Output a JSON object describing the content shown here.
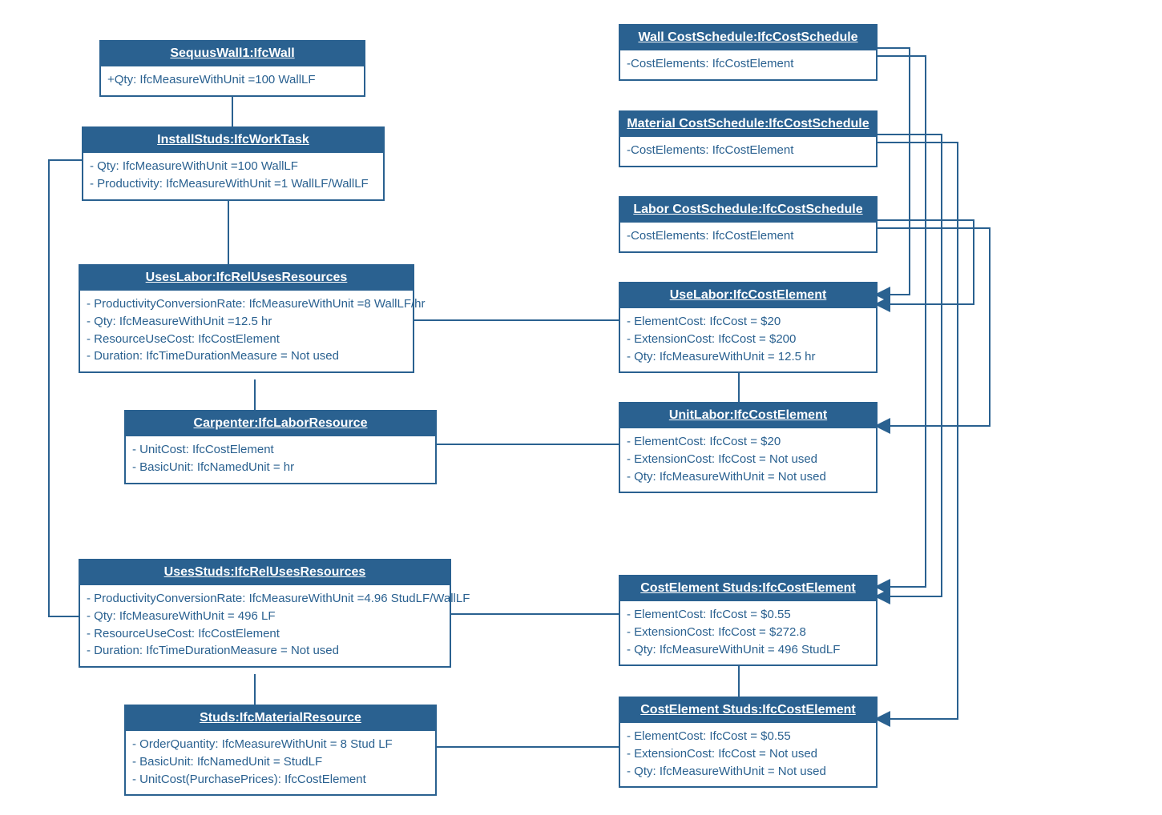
{
  "left": {
    "wall": {
      "title": "SequusWall1:IfcWall",
      "a1": "+Qty: IfcMeasureWithUnit =100 WallLF"
    },
    "install": {
      "title": "InstallStuds:IfcWorkTask",
      "a1": "- Qty: IfcMeasureWithUnit =100 WallLF",
      "a2": "- Productivity: IfcMeasureWithUnit =1 WallLF/WallLF"
    },
    "useslabor": {
      "title": "UsesLabor:IfcRelUsesResources",
      "a1": "- ProductivityConversionRate: IfcMeasureWithUnit =8 WallLF/hr",
      "a2": "- Qty: IfcMeasureWithUnit =12.5 hr",
      "a3": "- ResourceUseCost: IfcCostElement",
      "a4": "- Duration: IfcTimeDurationMeasure = Not used"
    },
    "carpenter": {
      "title": "Carpenter:IfcLaborResource",
      "a1": "- UnitCost: IfcCostElement",
      "a2": "- BasicUnit: IfcNamedUnit = hr"
    },
    "usesstuds": {
      "title": "UsesStuds:IfcRelUsesResources",
      "a1": "- ProductivityConversionRate: IfcMeasureWithUnit =4.96 StudLF/WallLF",
      "a2": "- Qty: IfcMeasureWithUnit = 496 LF",
      "a3": "- ResourceUseCost: IfcCostElement",
      "a4": "- Duration: IfcTimeDurationMeasure = Not used"
    },
    "studs": {
      "title": "Studs:IfcMaterialResource",
      "a1": "- OrderQuantity: IfcMeasureWithUnit = 8 Stud LF",
      "a2": "- BasicUnit: IfcNamedUnit = StudLF",
      "a3": "- UnitCost(PurchasePrices): IfcCostElement"
    }
  },
  "right": {
    "wallSched": {
      "title": "Wall CostSchedule:IfcCostSchedule",
      "a1": "-CostElements: IfcCostElement"
    },
    "matSched": {
      "title": "Material CostSchedule:IfcCostSchedule",
      "a1": "-CostElements: IfcCostElement"
    },
    "laborSched": {
      "title": "Labor CostSchedule:IfcCostSchedule",
      "a1": "-CostElements: IfcCostElement"
    },
    "useLaborCE": {
      "title": "UseLabor:IfcCostElement",
      "a1": "- ElementCost: IfcCost = $20",
      "a2": "- ExtensionCost: IfcCost = $200",
      "a3": "- Qty: IfcMeasureWithUnit = 12.5 hr"
    },
    "unitLaborCE": {
      "title": "UnitLabor:IfcCostElement",
      "a1": "- ElementCost: IfcCost = $20",
      "a2": "- ExtensionCost: IfcCost = Not used",
      "a3": "- Qty: IfcMeasureWithUnit = Not used"
    },
    "ceStuds": {
      "title": "CostElement Studs:IfcCostElement",
      "a1": "- ElementCost: IfcCost = $0.55",
      "a2": "- ExtensionCost: IfcCost = $272.8",
      "a3": "- Qty: IfcMeasureWithUnit = 496 StudLF"
    },
    "ceStuds2": {
      "title": "CostElement Studs:IfcCostElement",
      "a1": "- ElementCost: IfcCost = $0.55",
      "a2": "- ExtensionCost: IfcCost = Not used",
      "a3": "- Qty: IfcMeasureWithUnit = Not used"
    }
  }
}
